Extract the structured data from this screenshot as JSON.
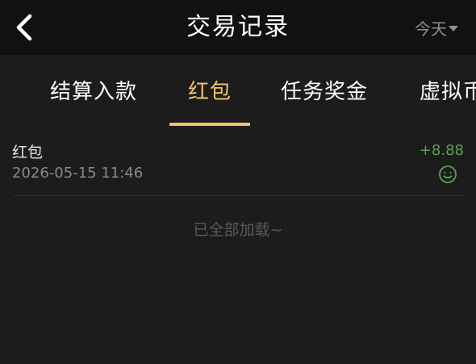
{
  "header": {
    "title": "交易记录",
    "filter_label": "今天",
    "back_icon": "chevron-left-icon",
    "filter_icon": "caret-down-icon"
  },
  "tabs": [
    {
      "label": "结算入款",
      "active": false
    },
    {
      "label": "红包",
      "active": true
    },
    {
      "label": "任务奖金",
      "active": false
    },
    {
      "label": "虚拟币",
      "active": false
    }
  ],
  "records": [
    {
      "title": "红包",
      "time": "2026-05-15 11:46",
      "amount": "+8.88",
      "icon": "smile-icon"
    }
  ],
  "list_footer": "已全部加载~",
  "colors": {
    "background": "#1c1c1c",
    "header_bg": "#111111",
    "accent": "#f0c469",
    "amount_positive": "#5f9e5b",
    "muted_text": "#8f8a80"
  }
}
